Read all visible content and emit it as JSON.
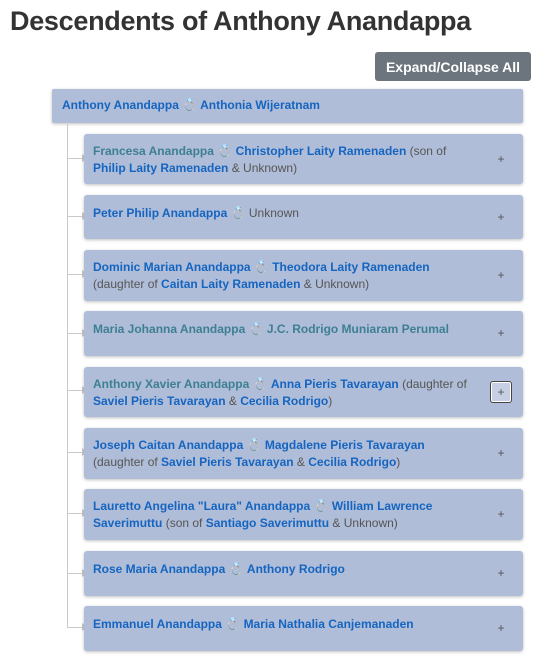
{
  "page": {
    "title": "Descendents of Anthony Anandappa"
  },
  "toolbar": {
    "expand_label": "Expand/Collapse All"
  },
  "root": {
    "person": "Anthony Anandappa",
    "ring": "💍",
    "spouse": "Anthonia Wijeratnam"
  },
  "children": [
    {
      "person": "Francesa Anandappa",
      "ring": "💍",
      "spouse": "Christopher Laity Ramenaden",
      "note_open": " (son of ",
      "parent1": "Philip Laity Ramenaden",
      "amp": " & ",
      "parent2": "Unknown",
      "note_close": ")",
      "toggle": "+"
    },
    {
      "person": "Peter Philip Anandappa",
      "ring": "💍",
      "spouse": "Unknown",
      "toggle": "+"
    },
    {
      "person": "Dominic Marian Anandappa",
      "ring": "💍",
      "spouse": "Theodora Laity Ramenaden",
      "note_open": " (daughter of ",
      "parent1": "Caitan Laity Ramenaden",
      "amp": " & ",
      "parent2": "Unknown",
      "note_close": ")",
      "toggle": "+"
    },
    {
      "person": "Maria Johanna Anandappa",
      "ring": "💍",
      "spouse": "J.C. Rodrigo Muniaram Perumal",
      "toggle": "+"
    },
    {
      "person": "Anthony Xavier Anandappa",
      "ring": "💍",
      "spouse": "Anna Pieris Tavarayan",
      "note_open": " (daughter of ",
      "parent1": "Saviel Pieris Tavarayan",
      "amp": " & ",
      "parent2": "Cecilia Rodrigo",
      "note_close": ")",
      "toggle": "+"
    },
    {
      "person": "Joseph Caitan Anandappa",
      "ring": "💍",
      "spouse": "Magdalene Pieris Tavarayan",
      "note_open": " (daughter of ",
      "parent1": "Saviel Pieris Tavarayan",
      "amp": " & ",
      "parent2": "Cecilia Rodrigo",
      "note_close": ")",
      "toggle": "+"
    },
    {
      "person": "Lauretto Angelina \"Laura\" Anandappa",
      "ring": "💍",
      "spouse": "William Lawrence Saverimuttu",
      "note_open": " (son of ",
      "parent1": "Santiago Saverimuttu",
      "amp": " & ",
      "parent2": "Unknown",
      "note_close": ")",
      "toggle": "+"
    },
    {
      "person": "Rose Maria Anandappa",
      "ring": "💍",
      "spouse": "Anthony Rodrigo",
      "toggle": "+"
    },
    {
      "person": "Emmanuel Anandappa",
      "ring": "💍",
      "spouse": "Maria Nathalia Canjemanaden",
      "toggle": "+"
    }
  ]
}
